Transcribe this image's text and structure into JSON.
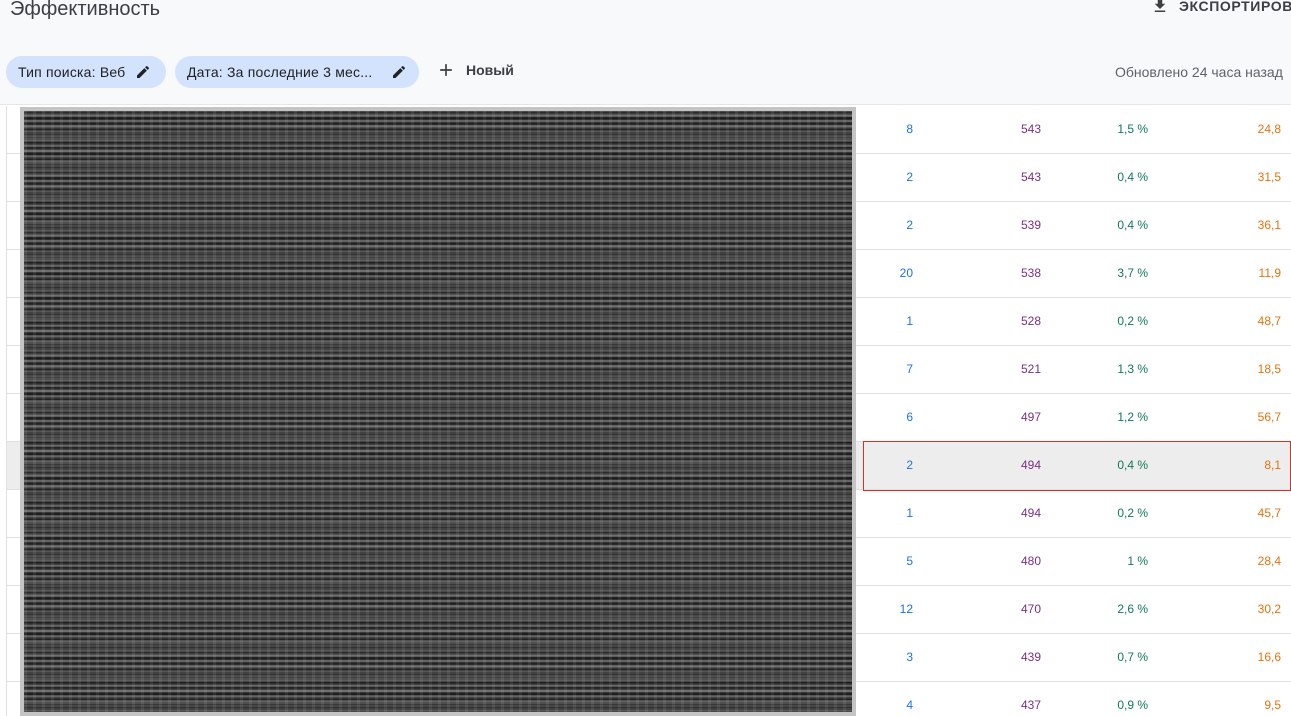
{
  "header": {
    "title": "Эффективность",
    "export_label": "ЭКСПОРТИРОВАТЬ",
    "export_icon": "download-icon"
  },
  "filters": {
    "chips": [
      {
        "label": "Тип поиска: Веб",
        "icon": "pencil-icon"
      },
      {
        "label": "Дата: За последние 3 мес...",
        "icon": "pencil-icon"
      }
    ],
    "new_label": "Новый",
    "new_icon": "plus-icon",
    "updated_text": "Обновлено 24 часа назад"
  },
  "table": {
    "rows": [
      {
        "clicks": "8",
        "impressions": "543",
        "ctr": "1,5 %",
        "position": "24,8"
      },
      {
        "clicks": "2",
        "impressions": "543",
        "ctr": "0,4 %",
        "position": "31,5"
      },
      {
        "clicks": "2",
        "impressions": "539",
        "ctr": "0,4 %",
        "position": "36,1"
      },
      {
        "clicks": "20",
        "impressions": "538",
        "ctr": "3,7 %",
        "position": "11,9"
      },
      {
        "clicks": "1",
        "impressions": "528",
        "ctr": "0,2 %",
        "position": "48,7"
      },
      {
        "clicks": "7",
        "impressions": "521",
        "ctr": "1,3 %",
        "position": "18,5"
      },
      {
        "clicks": "6",
        "impressions": "497",
        "ctr": "1,2 %",
        "position": "56,7"
      },
      {
        "clicks": "2",
        "impressions": "494",
        "ctr": "0,4 %",
        "position": "8,1"
      },
      {
        "clicks": "1",
        "impressions": "494",
        "ctr": "0,2 %",
        "position": "45,7"
      },
      {
        "clicks": "5",
        "impressions": "480",
        "ctr": "1 %",
        "position": "28,4"
      },
      {
        "clicks": "12",
        "impressions": "470",
        "ctr": "2,6 %",
        "position": "30,2"
      },
      {
        "clicks": "3",
        "impressions": "439",
        "ctr": "0,7 %",
        "position": "16,6"
      },
      {
        "clicks": "4",
        "impressions": "437",
        "ctr": "0,9 %",
        "position": "9,5"
      }
    ],
    "highlighted_row_index": 7
  },
  "colors": {
    "clicks": "#1a73e8",
    "impressions": "#7b2d8b",
    "ctr": "#0f7a5c",
    "position": "#e8710a",
    "chip_bg": "#d3e3fd",
    "selection": "#d93025"
  }
}
